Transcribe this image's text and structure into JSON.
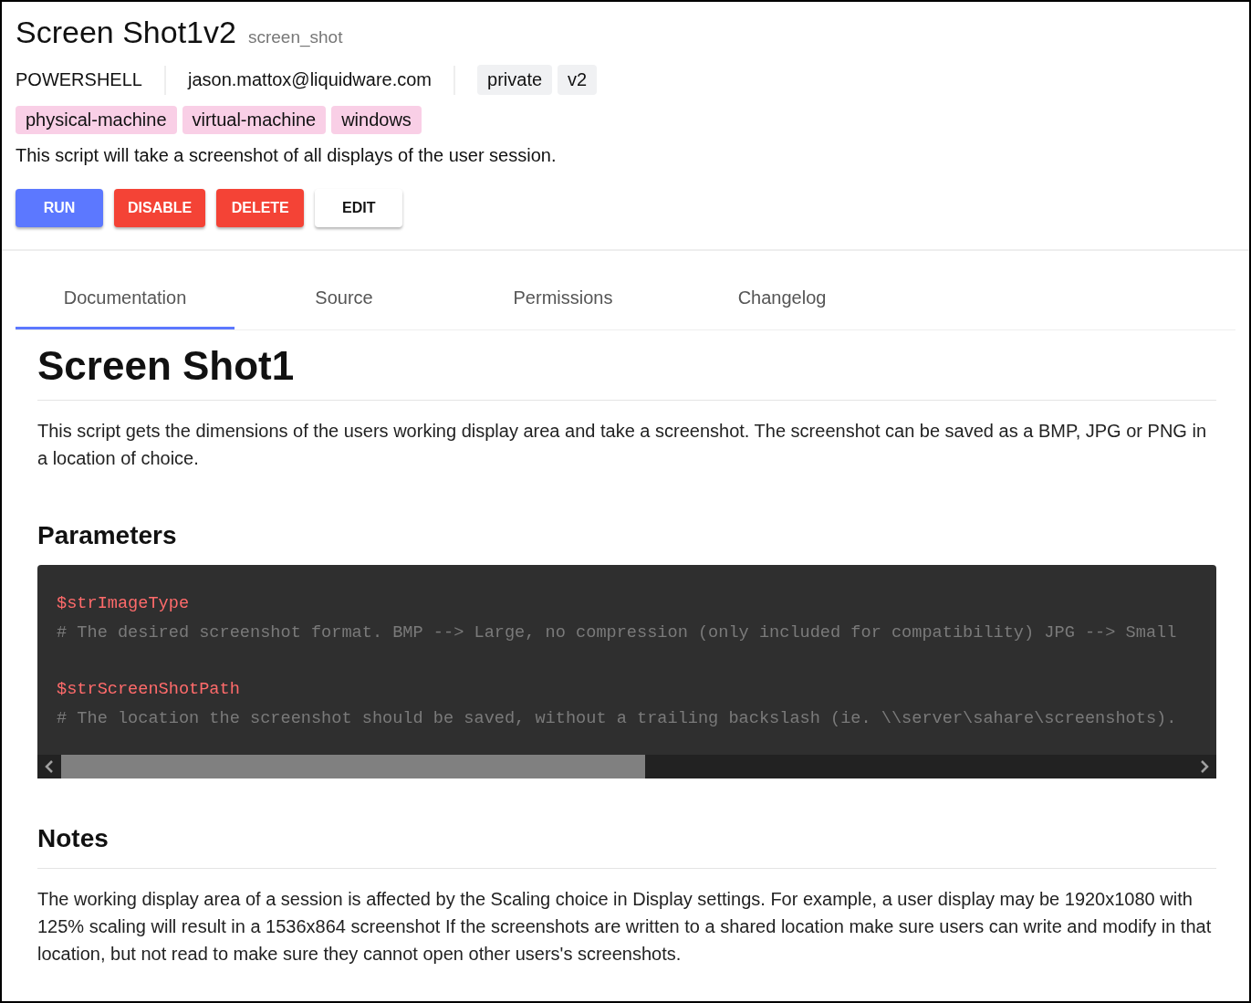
{
  "header": {
    "title": "Screen Shot1v2",
    "slug": "screen_shot"
  },
  "meta": {
    "language": "POWERSHELL",
    "author": "jason.mattox@liquidware.com",
    "badges": [
      "private",
      "v2"
    ]
  },
  "tags": [
    "physical-machine",
    "virtual-machine",
    "windows"
  ],
  "summary": "This script will take a screenshot of all displays of the user session.",
  "buttons": [
    {
      "label": "RUN",
      "kind": "primary"
    },
    {
      "label": "DISABLE",
      "kind": "danger"
    },
    {
      "label": "DELETE",
      "kind": "danger"
    },
    {
      "label": "EDIT",
      "kind": "plain"
    }
  ],
  "tabs": [
    {
      "label": "Documentation",
      "selected": true
    },
    {
      "label": "Source",
      "selected": false
    },
    {
      "label": "Permissions",
      "selected": false
    },
    {
      "label": "Changelog",
      "selected": false
    }
  ],
  "doc": {
    "title": "Screen Shot1",
    "intro": "This script gets the dimensions of the users working display area and take a screenshot. The screenshot can be saved as a BMP, JPG or PNG in a location of choice.",
    "parameters_heading": "Parameters",
    "parameters": [
      {
        "name": "$strImageType",
        "comment": "# The desired screenshot format. BMP --> Large, no compression (only included for compatibility) JPG --> Small"
      },
      {
        "name": "$strScreenShotPath",
        "comment": "# The location the screenshot should be saved, without a trailing backslash (ie. \\\\server\\sahare\\screenshots)."
      }
    ],
    "notes_heading": "Notes",
    "notes": "The working display area of a session is affected by the Scaling choice in Display settings. For example, a user display may be 1920x1080 with 125% scaling will result in a 1536x864 screenshot If the screenshots are written to a shared location make sure users can write and modify in that location, but not read to make sure they cannot open other users's screenshots."
  }
}
